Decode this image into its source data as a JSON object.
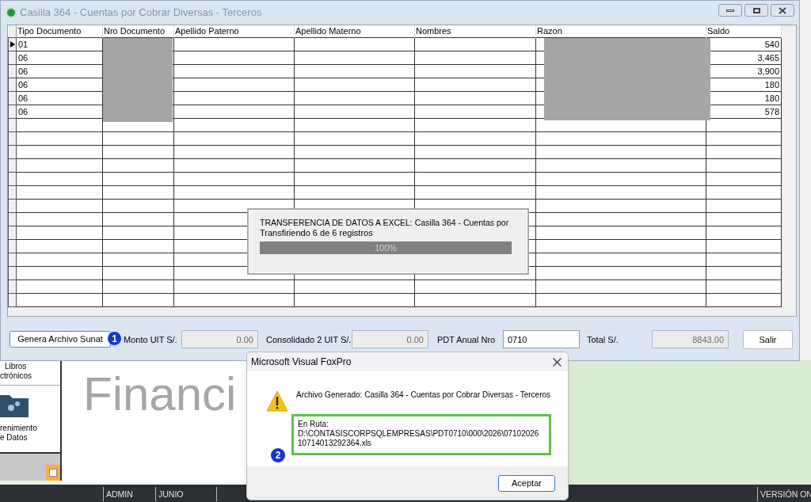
{
  "window": {
    "title": "Casilla 364 - Cuentas por Cobrar Diversas - Terceros"
  },
  "grid": {
    "columns": [
      "Tipo Documento",
      "Nro Documento",
      "Apellido Paterno",
      "Apellido Materno",
      "Nombres",
      "Razon",
      "Saldo"
    ],
    "rows": [
      {
        "tipo": "01",
        "saldo": "540",
        "selected": true
      },
      {
        "tipo": "06",
        "saldo": "3,465",
        "selected": false
      },
      {
        "tipo": "06",
        "saldo": "3,900",
        "selected": false
      },
      {
        "tipo": "06",
        "saldo": "180",
        "selected": false
      },
      {
        "tipo": "06",
        "saldo": "180",
        "selected": false
      },
      {
        "tipo": "06",
        "saldo": "578",
        "selected": false
      }
    ]
  },
  "footer": {
    "button": "Genera Archivo Sunat",
    "badge": "1",
    "fields": [
      {
        "label": "Monto UIT S/.",
        "value": "0.00",
        "disabled": true
      },
      {
        "label": "Consolidado 2 UIT S/.",
        "value": "0.00",
        "disabled": true
      },
      {
        "label": "PDT Anual Nro",
        "value": "0710",
        "disabled": false
      },
      {
        "label": "Total S/.",
        "value": "8843.00",
        "disabled": true
      }
    ],
    "exit_button": "Salir"
  },
  "progress": {
    "title": "TRANSFERENCIA DE DATOS A EXCEL: Casilla 364 - Cuentas por",
    "status": "Transfiriendo 6 de 6 registros",
    "level": 1,
    "reading": "100%"
  },
  "background": {
    "sidebar": [
      "Libros",
      "ctrónicos",
      "renimiento",
      "e Datos"
    ],
    "logo_text": "Financi",
    "status_bar": [
      "ADMIN",
      "JUNIO",
      "VERSIÓN ON"
    ]
  },
  "message_box": {
    "title": "Microsoft Visual FoxPro",
    "message": "Archivo Generado: Casilla 364 - Cuentas por Cobrar Diversas - Terceros",
    "path_label": "En Ruta:",
    "path": "D:\\CONTASISCORPSQLEMPRESAS\\PDT0710\\000\\2026\\07102026 10714013292364.xls",
    "badge": "2",
    "button": "Aceptar"
  }
}
